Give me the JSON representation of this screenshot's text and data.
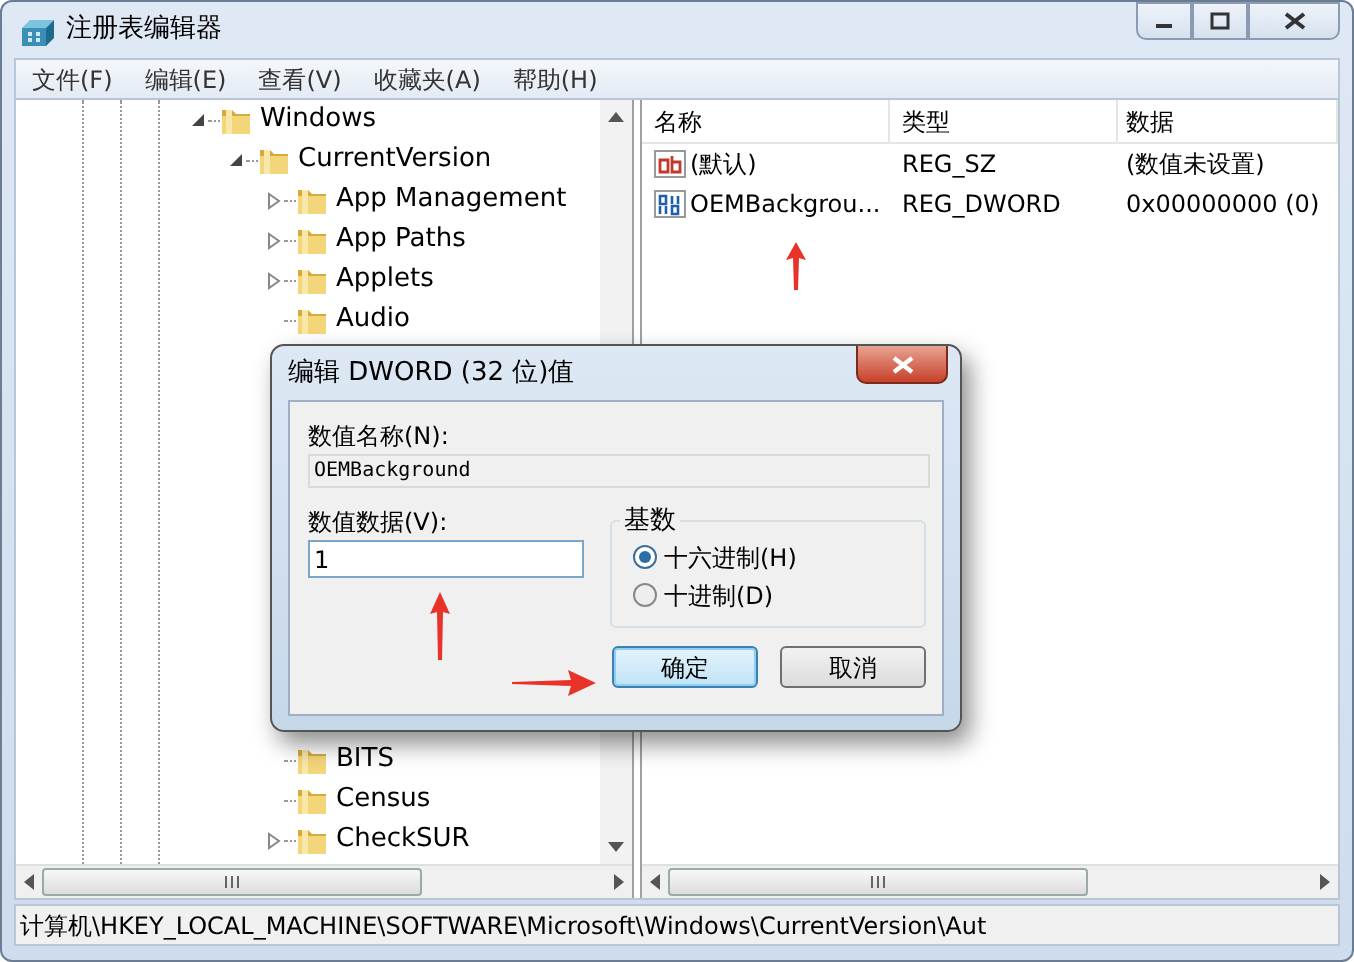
{
  "window": {
    "title": "注册表编辑器"
  },
  "menu": [
    {
      "label": "文件(F)"
    },
    {
      "label": "编辑(E)"
    },
    {
      "label": "查看(V)"
    },
    {
      "label": "收藏夹(A)"
    },
    {
      "label": "帮助(H)"
    }
  ],
  "tree": [
    {
      "label": "Windows",
      "expanded": true,
      "children": [
        {
          "label": "CurrentVersion",
          "expanded": true,
          "children": [
            {
              "label": "App Management",
              "expanded": false
            },
            {
              "label": "App Paths",
              "expanded": false
            },
            {
              "label": "Applets",
              "expanded": false
            },
            {
              "label": "Audio"
            },
            {
              "label": "BITS"
            },
            {
              "label": "Census"
            },
            {
              "label": "CheckSUR",
              "expanded": false
            }
          ]
        }
      ]
    }
  ],
  "list": {
    "columns": [
      "名称",
      "类型",
      "数据"
    ],
    "rows": [
      {
        "kind": "string",
        "name": "(默认)",
        "type": "REG_SZ",
        "data": "(数值未设置)"
      },
      {
        "kind": "binary",
        "name": "OEMBackgrou...",
        "type": "REG_DWORD",
        "data": "0x00000000 (0)"
      }
    ]
  },
  "dialog": {
    "title": "编辑 DWORD (32 位)值",
    "name_label": "数值名称(N):",
    "name_value": "OEMBackground",
    "data_label": "数值数据(V):",
    "data_value": "1",
    "base": {
      "title": "基数",
      "options": [
        {
          "label": "十六进制(H)",
          "selected": true
        },
        {
          "label": "十进制(D)",
          "selected": false
        }
      ]
    },
    "buttons": [
      {
        "label": "确定",
        "default": true
      },
      {
        "label": "取消",
        "default": false
      }
    ]
  },
  "status_bar": "计算机\\HKEY_LOCAL_MACHINE\\SOFTWARE\\Microsoft\\Windows\\CurrentVersion\\Aut"
}
